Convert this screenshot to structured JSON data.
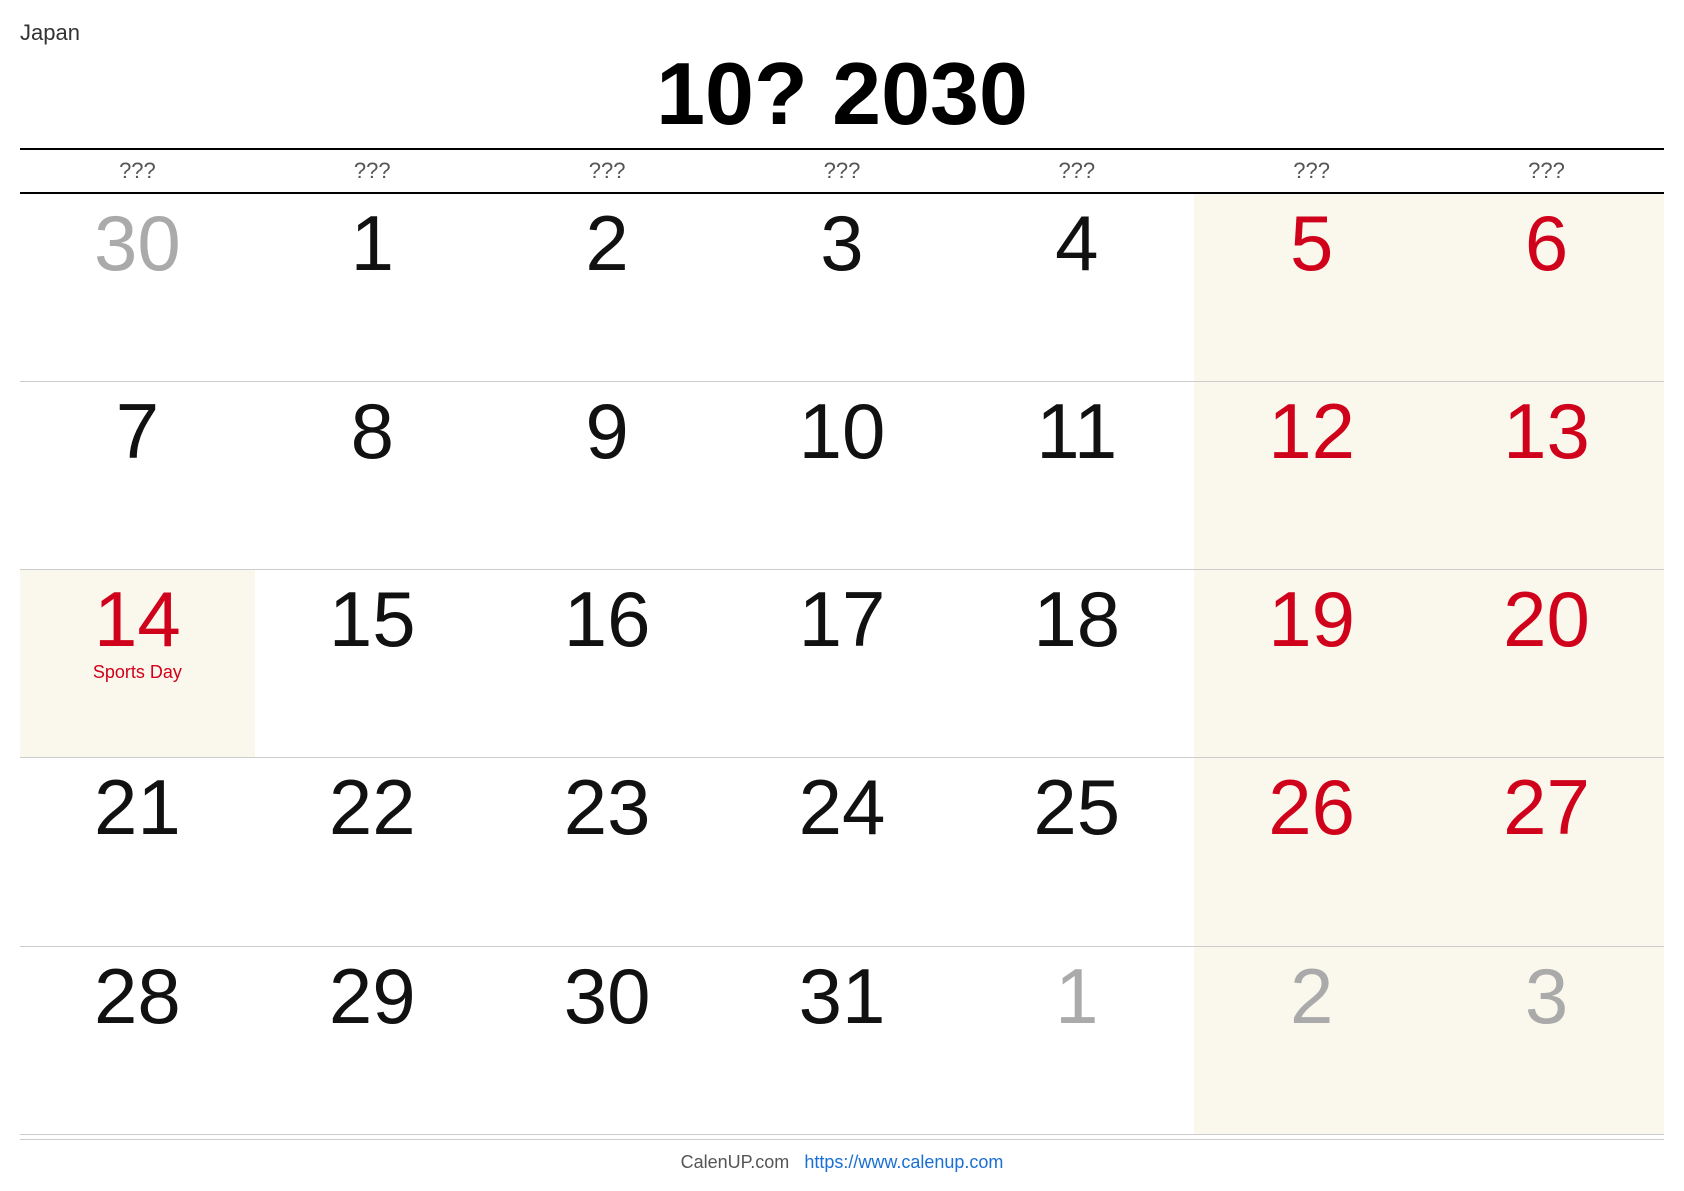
{
  "country": "Japan",
  "title": "10? 2030",
  "weekdays": [
    "???",
    "???",
    "???",
    "???",
    "???",
    "???",
    "???"
  ],
  "weeks": [
    [
      {
        "day": "30",
        "color": "gray",
        "holiday": "",
        "weekend": false
      },
      {
        "day": "1",
        "color": "black",
        "holiday": "",
        "weekend": false
      },
      {
        "day": "2",
        "color": "black",
        "holiday": "",
        "weekend": false
      },
      {
        "day": "3",
        "color": "black",
        "holiday": "",
        "weekend": false
      },
      {
        "day": "4",
        "color": "black",
        "holiday": "",
        "weekend": false
      },
      {
        "day": "5",
        "color": "red",
        "holiday": "",
        "weekend": true
      },
      {
        "day": "6",
        "color": "red",
        "holiday": "",
        "weekend": true
      }
    ],
    [
      {
        "day": "7",
        "color": "black",
        "holiday": "",
        "weekend": false
      },
      {
        "day": "8",
        "color": "black",
        "holiday": "",
        "weekend": false
      },
      {
        "day": "9",
        "color": "black",
        "holiday": "",
        "weekend": false
      },
      {
        "day": "10",
        "color": "black",
        "holiday": "",
        "weekend": false
      },
      {
        "day": "11",
        "color": "black",
        "holiday": "",
        "weekend": false
      },
      {
        "day": "12",
        "color": "red",
        "holiday": "",
        "weekend": true
      },
      {
        "day": "13",
        "color": "red",
        "holiday": "",
        "weekend": true
      }
    ],
    [
      {
        "day": "14",
        "color": "red",
        "holiday": "Sports Day",
        "weekend": true
      },
      {
        "day": "15",
        "color": "black",
        "holiday": "",
        "weekend": false
      },
      {
        "day": "16",
        "color": "black",
        "holiday": "",
        "weekend": false
      },
      {
        "day": "17",
        "color": "black",
        "holiday": "",
        "weekend": false
      },
      {
        "day": "18",
        "color": "black",
        "holiday": "",
        "weekend": false
      },
      {
        "day": "19",
        "color": "red",
        "holiday": "",
        "weekend": true
      },
      {
        "day": "20",
        "color": "red",
        "holiday": "",
        "weekend": true
      }
    ],
    [
      {
        "day": "21",
        "color": "black",
        "holiday": "",
        "weekend": false
      },
      {
        "day": "22",
        "color": "black",
        "holiday": "",
        "weekend": false
      },
      {
        "day": "23",
        "color": "black",
        "holiday": "",
        "weekend": false
      },
      {
        "day": "24",
        "color": "black",
        "holiday": "",
        "weekend": false
      },
      {
        "day": "25",
        "color": "black",
        "holiday": "",
        "weekend": false
      },
      {
        "day": "26",
        "color": "red",
        "holiday": "",
        "weekend": true
      },
      {
        "day": "27",
        "color": "red",
        "holiday": "",
        "weekend": true
      }
    ],
    [
      {
        "day": "28",
        "color": "black",
        "holiday": "",
        "weekend": false
      },
      {
        "day": "29",
        "color": "black",
        "holiday": "",
        "weekend": false
      },
      {
        "day": "30",
        "color": "black",
        "holiday": "",
        "weekend": false
      },
      {
        "day": "31",
        "color": "black",
        "holiday": "",
        "weekend": false
      },
      {
        "day": "1",
        "color": "gray",
        "holiday": "",
        "weekend": false
      },
      {
        "day": "2",
        "color": "gray",
        "holiday": "",
        "weekend": true
      },
      {
        "day": "3",
        "color": "gray",
        "holiday": "",
        "weekend": true
      }
    ]
  ],
  "footer": {
    "site_name": "CalenUP.com",
    "site_url_text": "https://www.calenup.com"
  }
}
